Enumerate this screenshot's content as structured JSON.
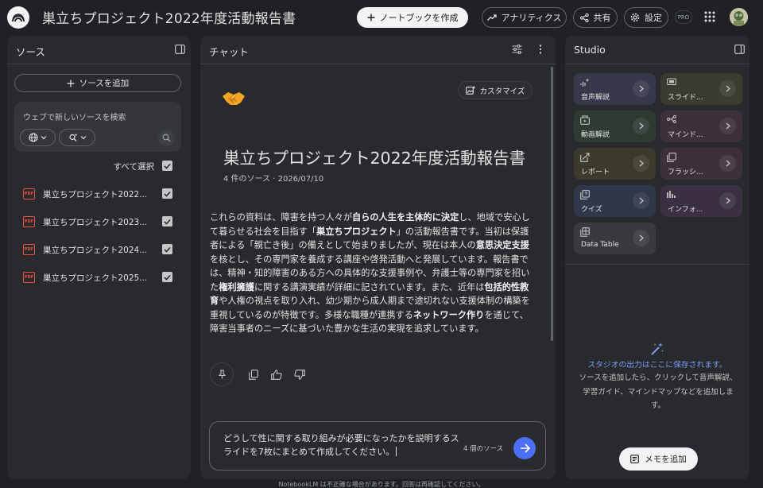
{
  "app": {
    "title": "巣立ちプロジェクト2022年度活動報告書"
  },
  "topbar": {
    "create_notebook_label": "ノートブックを作成",
    "analytics_label": "アナリティクス",
    "share_label": "共有",
    "settings_label": "設定",
    "pro_badge": "PRO"
  },
  "sources": {
    "title": "ソース",
    "add_source_label": "ソースを追加",
    "search_placeholder": "ウェブで新しいソースを検索",
    "select_all_label": "すべて選択",
    "items": [
      {
        "label": "巣立ちプロジェクト2022...",
        "checked": true
      },
      {
        "label": "巣立ちプロジェクト2023...",
        "checked": true
      },
      {
        "label": "巣立ちプロジェクト2024...",
        "checked": true
      },
      {
        "label": "巣立ちプロジェクト2025...",
        "checked": true
      }
    ],
    "file_type": "PDF"
  },
  "chat": {
    "title": "チャット",
    "customize_label": "カスタマイズ",
    "emoji": "🤝",
    "notebook_title": "巣立ちプロジェクト2022年度活動報告書",
    "meta": "4 件のソース · 2026/07/10",
    "summary": [
      {
        "t": "これらの資料は、障害を持つ人々が",
        "b": false
      },
      {
        "t": "自らの人生を主体的に決定",
        "b": true
      },
      {
        "t": "し、地域で安心して暮らせる社会を目指す「",
        "b": false
      },
      {
        "t": "巣立ちプロジェクト",
        "b": true
      },
      {
        "t": "」の活動報告書です。当初は保護者による「親亡き後」の備えとして始まりましたが、現在は本人の",
        "b": false
      },
      {
        "t": "意思決定支援",
        "b": true
      },
      {
        "t": "を核とし、その専門家を養成する講座や啓発活動へと発展しています。報告書では、精神・知的障害のある方への具体的な支援事例や、弁護士等の専門家を招いた",
        "b": false
      },
      {
        "t": "権利擁護",
        "b": true
      },
      {
        "t": "に関する講演実績が詳細に記されています。また、近年は",
        "b": false
      },
      {
        "t": "包括的性教育",
        "b": true
      },
      {
        "t": "や人権の視点を取り入れ、幼少期から成人期まで途切れない支援体制の構築を重視しているのが特徴です。多様な職種が連携する",
        "b": false
      },
      {
        "t": "ネットワーク作り",
        "b": true
      },
      {
        "t": "を通じて、障害当事者のニーズに基づいた豊かな生活の実現を追求しています。",
        "b": false
      }
    ],
    "composer_text": "どうして性に関する取り組みが必要になったかを説明するスライドを7枚にまとめて作成してください。",
    "source_count": "4 個のソース"
  },
  "studio": {
    "title": "Studio",
    "tiles": [
      {
        "label": "音声解説",
        "icon": "audio-sparkle-icon",
        "color": "#36394a"
      },
      {
        "label": "スライド...",
        "icon": "slides-icon",
        "color": "#3c3b2f"
      },
      {
        "label": "動画解説",
        "icon": "video-icon",
        "color": "#2f3a33"
      },
      {
        "label": "マインド...",
        "icon": "mindmap-icon",
        "color": "#3d3039"
      },
      {
        "label": "レポート",
        "icon": "report-icon",
        "color": "#3b3a2c"
      },
      {
        "label": "フラッシ...",
        "icon": "flashcards-icon",
        "color": "#3d3039"
      },
      {
        "label": "クイズ",
        "icon": "quiz-icon",
        "color": "#30374a"
      },
      {
        "label": "インフォ...",
        "icon": "infographic-icon",
        "color": "#3a3042"
      },
      {
        "label": "Data Table",
        "icon": "table-icon",
        "color": "#393a3f"
      }
    ],
    "empty_title": "スタジオの出力はここに保存されます。",
    "empty_desc": "ソースを追加したら、クリックして音声解説、学習ガイド、マインドマップなどを追加します。",
    "add_note_label": "メモを追加"
  },
  "footer": {
    "disclaimer": "NotebookLM は不正確な場合があります。回答は再確認してください。"
  }
}
